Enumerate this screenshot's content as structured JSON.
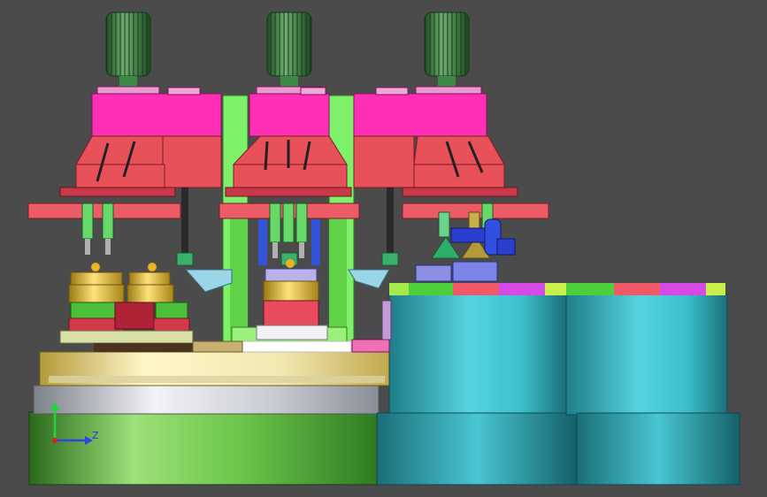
{
  "viewport": {
    "background": "#4b4b4b",
    "description_name": "cad-3d-viewport"
  },
  "axis_triad": {
    "x_label": "",
    "y_label": "",
    "z_label": "Z",
    "y_color": "#1fd63b",
    "z_color": "#2a47e0",
    "origin_color": "#d82020"
  },
  "colors": {
    "magenta_housing": "#ff2fb6",
    "red_bracket": "#e8505a",
    "green_frame": "#7ef06a",
    "knob_green": "#2f7d3a",
    "gold": "#e6c23a",
    "cyan_drum": "#3ec4d0",
    "base_green": "#4aa82f",
    "plate_tan": "#e8e0a0"
  },
  "icons": [
    "axis-triad-icon"
  ]
}
